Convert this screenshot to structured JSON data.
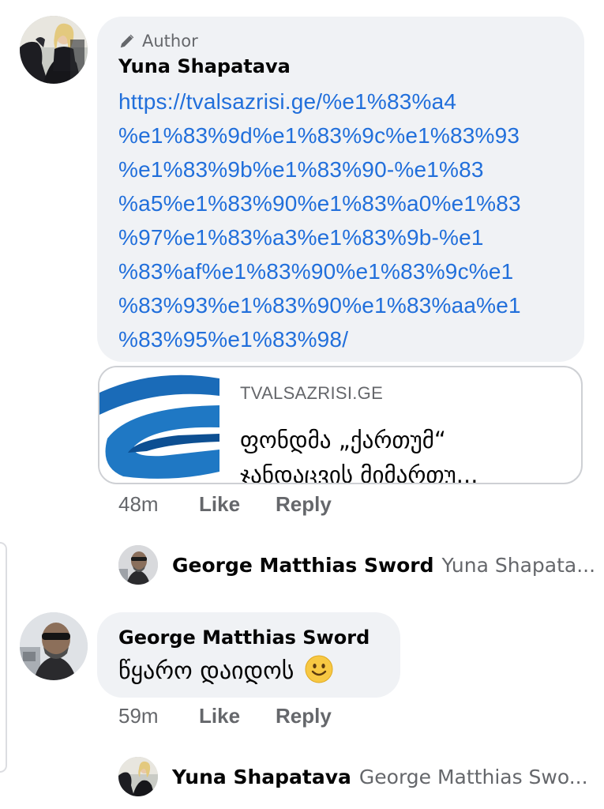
{
  "comment1": {
    "author_badge": "Author",
    "name": "Yuna Shapatava",
    "link_lines": [
      "https://tvalsazrisi.ge/%e1%83%a4",
      "%e1%83%9d%e1%83%9c%e1%83%93",
      "%e1%83%9b%e1%83%90-%e1%83",
      "%a5%e1%83%90%e1%83%a0%e1%83",
      "%97%e1%83%a3%e1%83%9b-%e1",
      "%83%af%e1%83%90%e1%83%9c%e1",
      "%83%93%e1%83%90%e1%83%aa%e1",
      "%83%95%e1%83%98/"
    ],
    "preview": {
      "domain": "TVALSAZRISI.GE",
      "title_lines": [
        "ფონდმა „ქართუმ“",
        "ჯანდაცვის მიმართუ..."
      ]
    },
    "time": "48m",
    "like": "Like",
    "reply": "Reply"
  },
  "reply_preview1": {
    "name": "George Matthias Sword",
    "snippet": "Yuna Shapata..."
  },
  "comment2": {
    "name": "George Matthias Sword",
    "text": "წყარო დაიდოს",
    "emoji": "smiling-face-emoji",
    "time": "59m",
    "like": "Like",
    "reply": "Reply"
  },
  "reply_preview2": {
    "name": "Yuna Shapatava",
    "snippet": "George Matthias Swo..."
  },
  "colors": {
    "link": "#216fdb",
    "secondary_text": "#65676b",
    "bubble_bg": "#f0f2f5"
  }
}
